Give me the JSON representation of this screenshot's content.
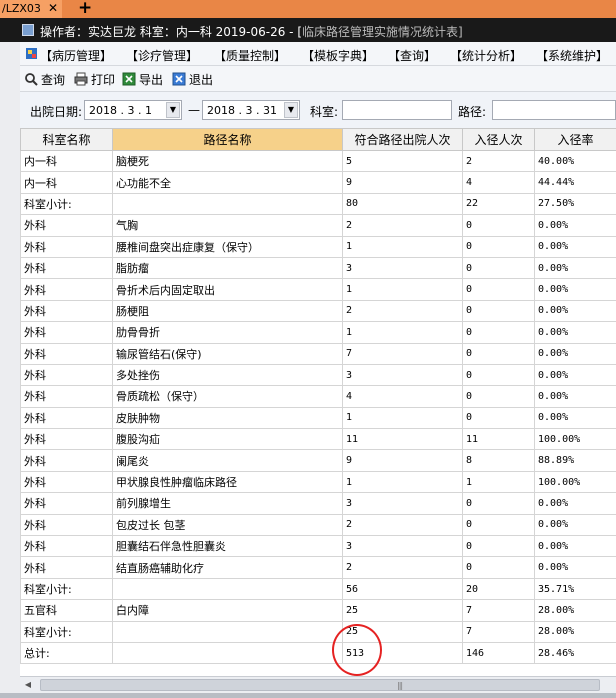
{
  "browser_tab": {
    "title": "/LZX03",
    "close_glyph": "✕",
    "add_glyph": "+"
  },
  "window": {
    "title_main": "操作者：实达巨龙  科室：内一科  2019-06-26 - [",
    "title_form": "临床路径管理实施情况统计表",
    "title_end": "]"
  },
  "menu": {
    "items": [
      "【病历管理】",
      "【诊疗管理】",
      "【质量控制】",
      "【模板字典】",
      "【查询】",
      "【统计分析】",
      "【系统维护】"
    ]
  },
  "toolbar": {
    "query": "查询",
    "print": "打印",
    "export": "导出",
    "exit": "退出"
  },
  "filters": {
    "discharge_date_label": "出院日期:",
    "date_from": "2018 . 3 . 1",
    "date_separator": "—",
    "date_to": "2018 . 3 . 31",
    "department_label": "科室:",
    "department_value": "",
    "pathway_label": "路径:",
    "pathway_value": ""
  },
  "table": {
    "headers": [
      "科室名称",
      "路径名称",
      "符合路径出院人次",
      "入径人次",
      "入径率"
    ],
    "rows": [
      [
        "内一科",
        "脑梗死",
        "5",
        "2",
        "40.00%"
      ],
      [
        "内一科",
        "心功能不全",
        "9",
        "4",
        "44.44%"
      ],
      [
        "科室小计:",
        "",
        "80",
        "22",
        "27.50%"
      ],
      [
        "外科",
        "气胸",
        "2",
        "0",
        "0.00%"
      ],
      [
        "外科",
        "腰椎间盘突出症康复（保守）",
        "1",
        "0",
        "0.00%"
      ],
      [
        "外科",
        "脂肪瘤",
        "3",
        "0",
        "0.00%"
      ],
      [
        "外科",
        "骨折术后内固定取出",
        "1",
        "0",
        "0.00%"
      ],
      [
        "外科",
        "肠梗阻",
        "2",
        "0",
        "0.00%"
      ],
      [
        "外科",
        "肋骨骨折",
        "1",
        "0",
        "0.00%"
      ],
      [
        "外科",
        "输尿管结石(保守)",
        "7",
        "0",
        "0.00%"
      ],
      [
        "外科",
        "多处挫伤",
        "3",
        "0",
        "0.00%"
      ],
      [
        "外科",
        "骨质疏松（保守）",
        "4",
        "0",
        "0.00%"
      ],
      [
        "外科",
        "皮肤肿物",
        "1",
        "0",
        "0.00%"
      ],
      [
        "外科",
        "腹股沟疝",
        "11",
        "11",
        "100.00%"
      ],
      [
        "外科",
        "阑尾炎",
        "9",
        "8",
        "88.89%"
      ],
      [
        "外科",
        "甲状腺良性肿瘤临床路径",
        "1",
        "1",
        "100.00%"
      ],
      [
        "外科",
        "前列腺增生",
        "3",
        "0",
        "0.00%"
      ],
      [
        "外科",
        "包皮过长 包茎",
        "2",
        "0",
        "0.00%"
      ],
      [
        "外科",
        "胆囊结石伴急性胆囊炎",
        "3",
        "0",
        "0.00%"
      ],
      [
        "外科",
        "结直肠癌辅助化疗",
        "2",
        "0",
        "0.00%"
      ],
      [
        "科室小计:",
        "",
        "56",
        "20",
        "35.71%"
      ],
      [
        "五官科",
        "白内障",
        "25",
        "7",
        "28.00%"
      ],
      [
        "科室小计:",
        "",
        "25",
        "7",
        "28.00%"
      ],
      [
        "总计:",
        "",
        "513",
        "146",
        "28.46%"
      ]
    ]
  },
  "colors": {
    "active_header": "#f6d18a",
    "title_bar": "#191919",
    "annotation": "#e52222"
  }
}
